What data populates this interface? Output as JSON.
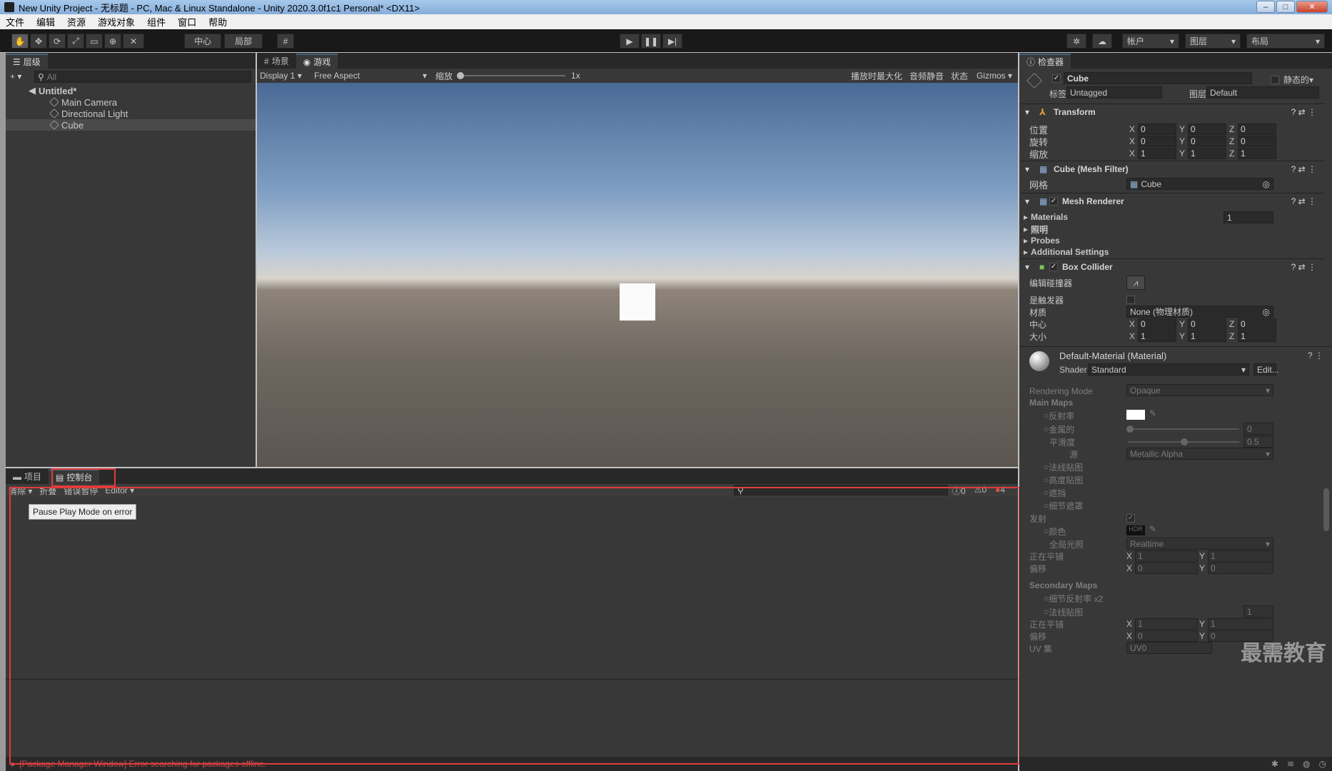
{
  "window": {
    "title": "New Unity Project - 无标题 - PC, Mac & Linux Standalone - Unity 2020.3.0f1c1 Personal* <DX11>",
    "buttons": [
      "–",
      "□",
      "✕"
    ]
  },
  "menu": [
    "文件",
    "编辑",
    "资源",
    "游戏对象",
    "组件",
    "窗口",
    "帮助"
  ],
  "toolbar": {
    "pivot": "中心",
    "local": "局部",
    "account": "帐户",
    "layers": "图层",
    "layout": "布局"
  },
  "hierarchy": {
    "tab": "层级",
    "search_placeholder": "All",
    "scene": "Untitled*",
    "items": [
      "Main Camera",
      "Directional Light",
      "Cube"
    ]
  },
  "game": {
    "tabs": [
      "场景",
      "游戏"
    ],
    "display": "Display 1",
    "aspect": "Free Aspect",
    "scale_label": "缩放",
    "scale_value": "1x",
    "opts": [
      "播放时最大化",
      "音频静音",
      "状态",
      "Gizmos"
    ]
  },
  "bottom": {
    "tabs": [
      "项目",
      "控制台"
    ],
    "clear": "清除",
    "collapse": "折叠",
    "error_pause": "错误暂停",
    "editor": "Editor",
    "counts": [
      "0",
      "0",
      "4"
    ],
    "tooltip": "Pause Play Mode on error",
    "status": "[Package Manager Window] Error searching for packages offline."
  },
  "inspector": {
    "tab": "检查器",
    "object": "Cube",
    "static": "静态的",
    "tag_label": "标签",
    "tag": "Untagged",
    "layer_label": "图层",
    "layer": "Default",
    "transform": {
      "title": "Transform",
      "rows": [
        {
          "label": "位置",
          "x": "0",
          "y": "0",
          "z": "0"
        },
        {
          "label": "旋转",
          "x": "0",
          "y": "0",
          "z": "0"
        },
        {
          "label": "缩放",
          "x": "1",
          "y": "1",
          "z": "1"
        }
      ]
    },
    "meshfilter": {
      "title": "Cube (Mesh Filter)",
      "mesh_label": "网格",
      "mesh": "Cube"
    },
    "renderer": {
      "title": "Mesh Renderer",
      "materials": "Materials",
      "materials_count": "1",
      "lighting": "照明",
      "probes": "Probes",
      "additional": "Additional Settings"
    },
    "collider": {
      "title": "Box Collider",
      "edit": "编辑碰撞器",
      "trigger": "是触发器",
      "material_label": "材质",
      "material": "None (物理材质)",
      "center_label": "中心",
      "center": {
        "x": "0",
        "y": "0",
        "z": "0"
      },
      "size_label": "大小",
      "size": {
        "x": "1",
        "y": "1",
        "z": "1"
      }
    },
    "material": {
      "title": "Default-Material (Material)",
      "shader_label": "Shader",
      "shader": "Standard",
      "edit": "Edit...",
      "rendering_mode_label": "Rendering Mode",
      "rendering_mode": "Opaque",
      "main_maps": "Main Maps",
      "albedo": "反射率",
      "metallic": "金属的",
      "metallic_value": "0",
      "smoothness": "平滑度",
      "smoothness_value": "0.5",
      "source": "源",
      "source_value": "Metallic Alpha",
      "normal": "法线贴图",
      "height": "高度贴图",
      "occlusion": "遮挡",
      "detail_mask": "细节遮罩",
      "emission": "发射",
      "color": "颜色",
      "hdr": "HDR",
      "gi": "全局光照",
      "gi_value": "Realtime",
      "tiling": "正在平铺",
      "tiling_x": "1",
      "tiling_y": "1",
      "offset": "偏移",
      "offset_x": "0",
      "offset_y": "0",
      "secondary": "Secondary Maps",
      "detail_albedo": "细节反射率 x2",
      "normal2": "法线贴图",
      "normal2_value": "1",
      "tiling2_x": "1",
      "tiling2_y": "1",
      "offset2_x": "0",
      "offset2_y": "0",
      "uv": "UV 集",
      "uv_value": "UV0"
    }
  },
  "watermark": "最需教育"
}
